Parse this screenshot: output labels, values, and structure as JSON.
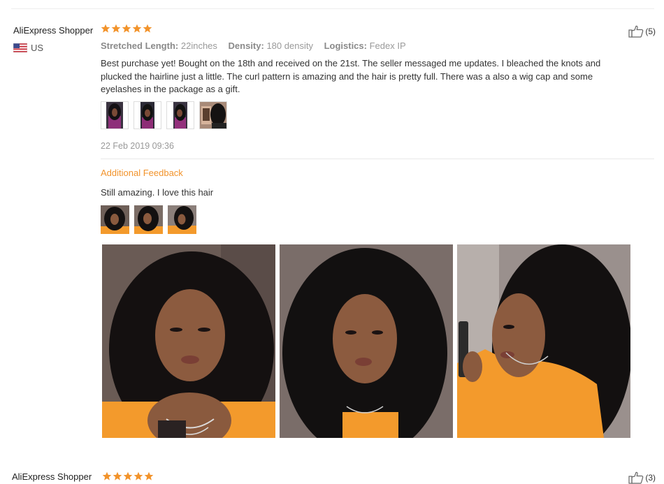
{
  "review": {
    "user": "AliExpress Shopper",
    "country": "US",
    "rating_stars": 5,
    "likes": "(5)",
    "attributes": [
      {
        "key": "Stretched Length:",
        "value": "22inches"
      },
      {
        "key": "Density:",
        "value": "180 density"
      },
      {
        "key": "Logistics:",
        "value": "Fedex IP"
      }
    ],
    "text": "Best purchase yet! Bought on the 18th and received on the 21st. The seller messaged me updates. I bleached the knots and plucked the hairline just a little. The curl pattern is amazing and the hair is pretty full. There was a also a wig cap and some eyelashes in the package as a gift.",
    "date": "22 Feb 2019 09:36",
    "additional_feedback": {
      "title": "Additional Feedback",
      "text": "Still amazing. I love this hair"
    }
  },
  "next_review": {
    "user": "AliExpress Shopper",
    "likes": "(3)"
  },
  "colors": {
    "star": "#f2932b",
    "accent": "#f2932b",
    "sweater": "#f39a2c"
  }
}
